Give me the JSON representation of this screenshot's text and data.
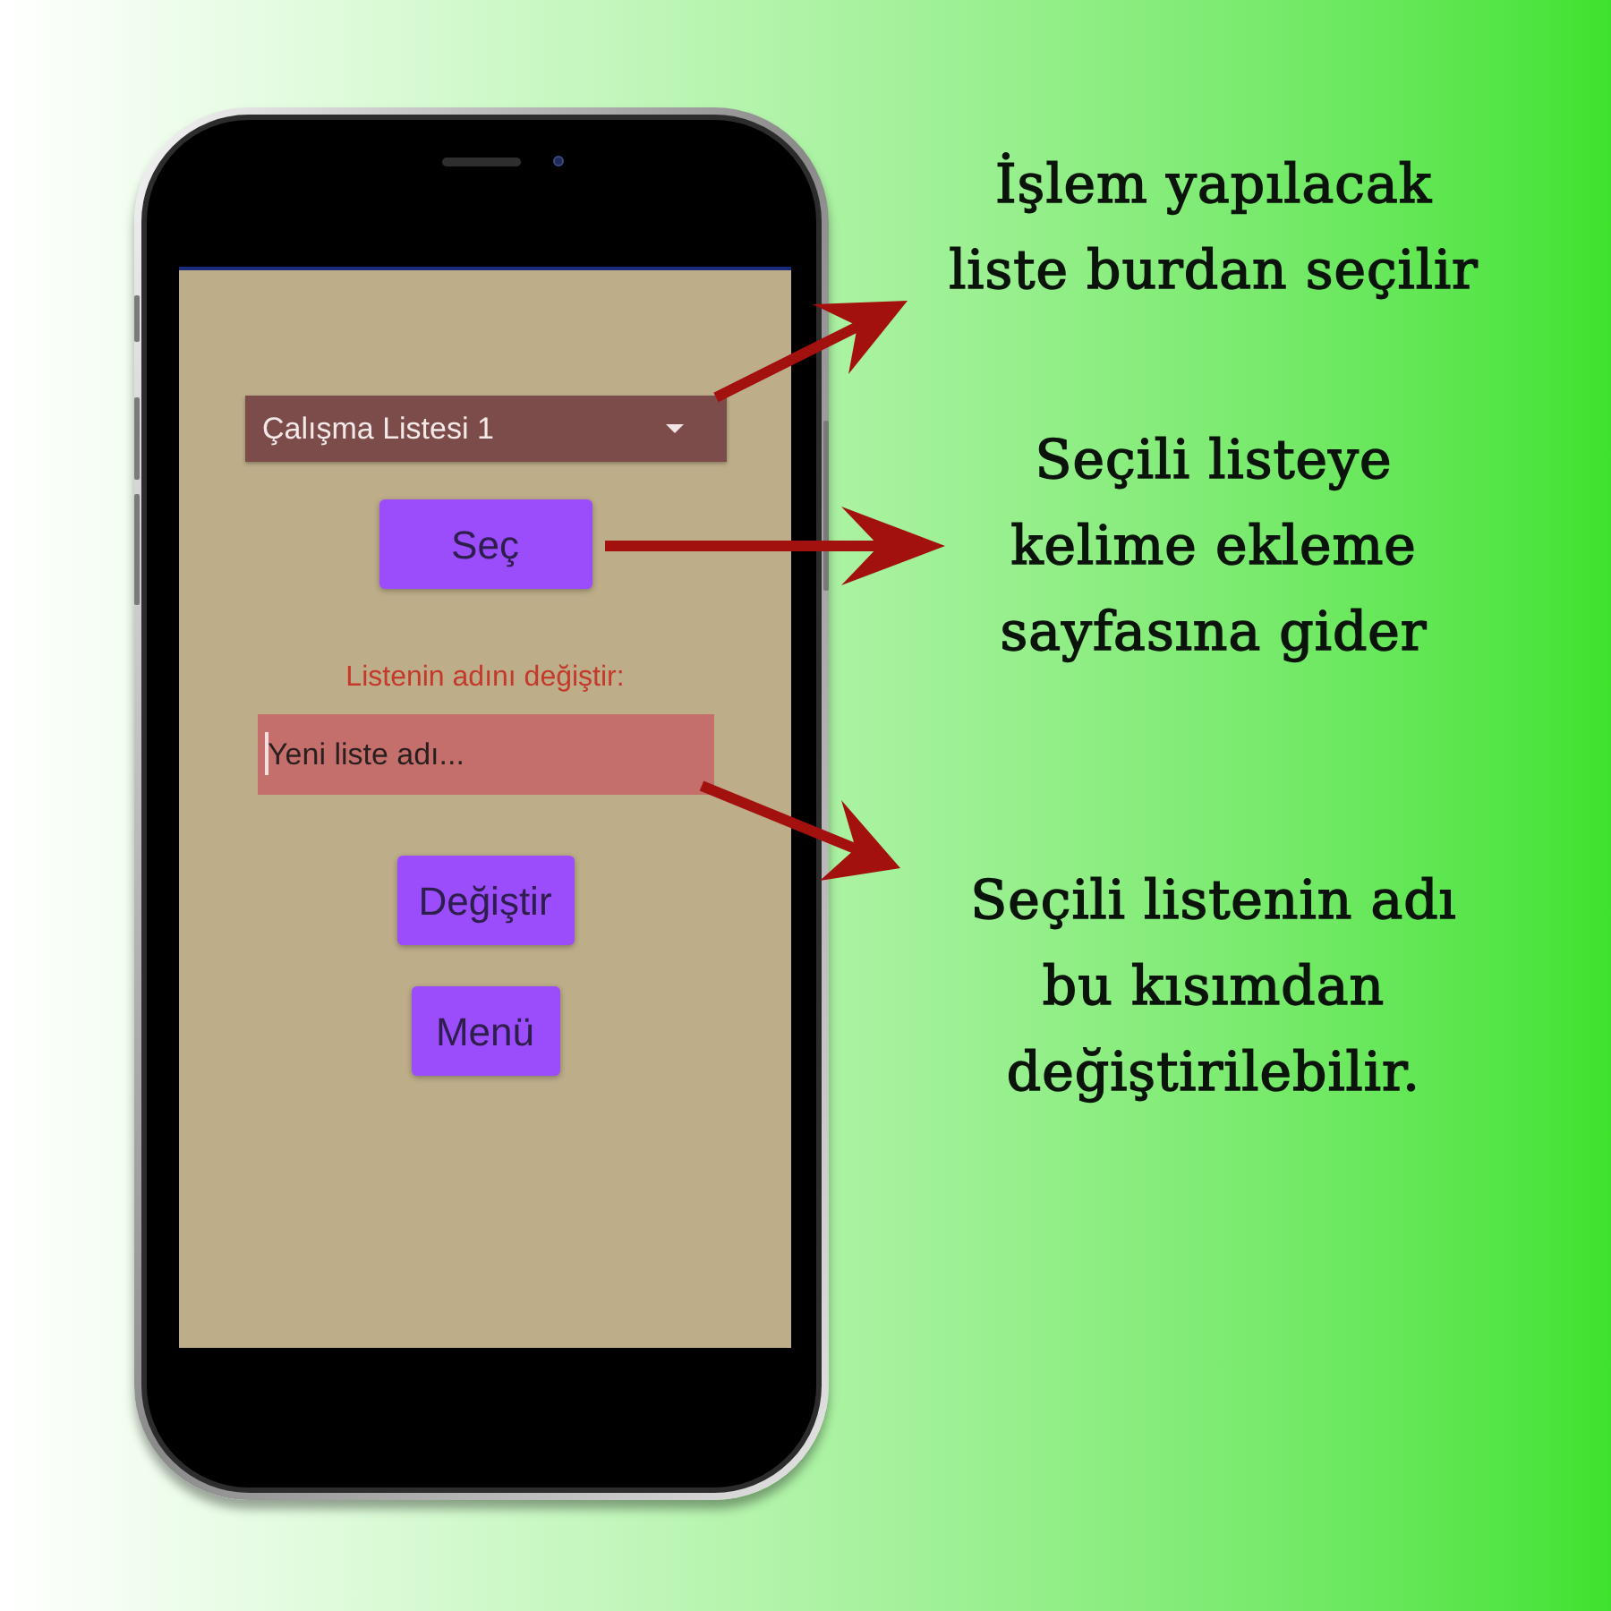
{
  "phone": {
    "screen": {
      "items": [
        {
          "kind": "dropdown",
          "value": "Çalışma Listesi 1"
        },
        {
          "kind": "button",
          "label": "Seç"
        },
        {
          "kind": "label",
          "text": "Listenin adını değiştir:"
        },
        {
          "kind": "text_field",
          "placeholder": "Yeni liste adı...",
          "focused": true
        },
        {
          "kind": "button",
          "label": "Değiştir"
        },
        {
          "kind": "button",
          "label": "Menü"
        }
      ]
    }
  },
  "annotations": [
    {
      "lines": [
        "İşlem yapılacak",
        "liste burdan seçilir"
      ]
    },
    {
      "lines": [
        "Seçili listeye",
        "kelime ekleme",
        "sayfasına gider"
      ]
    },
    {
      "lines": [
        "Seçili listenin adı",
        "bu kısımdan",
        "değiştirilebilir."
      ]
    }
  ]
}
